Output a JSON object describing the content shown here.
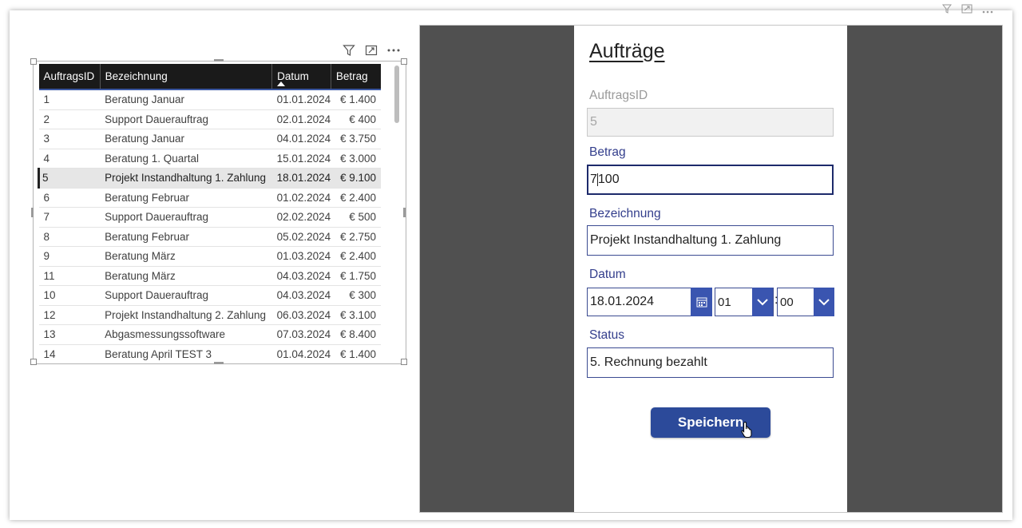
{
  "table": {
    "headers": [
      "AuftragsID",
      "Bezeichnung",
      "Datum",
      "Betrag"
    ],
    "rows": [
      {
        "id": "1",
        "bezeichnung": "Beratung Januar",
        "datum": "01.01.2024",
        "betrag": "€ 1.400"
      },
      {
        "id": "2",
        "bezeichnung": "Support Dauerauftrag",
        "datum": "02.01.2024",
        "betrag": "€ 400"
      },
      {
        "id": "3",
        "bezeichnung": "Beratung Januar",
        "datum": "04.01.2024",
        "betrag": "€ 3.750"
      },
      {
        "id": "4",
        "bezeichnung": "Beratung 1. Quartal",
        "datum": "15.01.2024",
        "betrag": "€ 3.000"
      },
      {
        "id": "5",
        "bezeichnung": "Projekt Instandhaltung 1. Zahlung",
        "datum": "18.01.2024",
        "betrag": "€ 9.100"
      },
      {
        "id": "6",
        "bezeichnung": "Beratung Februar",
        "datum": "01.02.2024",
        "betrag": "€ 2.400"
      },
      {
        "id": "7",
        "bezeichnung": "Support Dauerauftrag",
        "datum": "02.02.2024",
        "betrag": "€ 500"
      },
      {
        "id": "8",
        "bezeichnung": "Beratung Februar",
        "datum": "05.02.2024",
        "betrag": "€ 2.750"
      },
      {
        "id": "9",
        "bezeichnung": "Beratung März",
        "datum": "01.03.2024",
        "betrag": "€ 2.400"
      },
      {
        "id": "11",
        "bezeichnung": "Beratung März",
        "datum": "04.03.2024",
        "betrag": "€ 1.750"
      },
      {
        "id": "10",
        "bezeichnung": "Support Dauerauftrag",
        "datum": "04.03.2024",
        "betrag": "€ 300"
      },
      {
        "id": "12",
        "bezeichnung": "Projekt Instandhaltung 2. Zahlung",
        "datum": "06.03.2024",
        "betrag": "€ 3.100"
      },
      {
        "id": "13",
        "bezeichnung": "Abgasmessungssoftware",
        "datum": "07.03.2024",
        "betrag": "€ 8.400"
      },
      {
        "id": "14",
        "bezeichnung": "Beratung April TEST 3",
        "datum": "01.04.2024",
        "betrag": "€ 1.400"
      }
    ],
    "selected_row_id": "5",
    "sorted_column": "Datum",
    "toolbar_icons": [
      "filter-icon",
      "focus-mode-icon",
      "more-options-icon"
    ]
  },
  "form": {
    "title": "Aufträge",
    "auftragsid_label": "AuftragsID",
    "auftragsid_value": "5",
    "betrag_label": "Betrag",
    "betrag_before_caret": "7",
    "betrag_after_caret": "100",
    "bezeichnung_label": "Bezeichnung",
    "bezeichnung_value": "Projekt Instandhaltung 1. Zahlung",
    "datum_label": "Datum",
    "datum_value": "18.01.2024",
    "hour_value": "01",
    "minute_value": "00",
    "colon": ":",
    "status_label": "Status",
    "status_value": "5. Rechnung bezahlt",
    "save_label": "Speichern"
  },
  "colors": {
    "header_bg": "#1a1a1a",
    "accent_blue": "#2c4a9a",
    "label_blue": "#333e8c",
    "app_background": "#505050"
  }
}
